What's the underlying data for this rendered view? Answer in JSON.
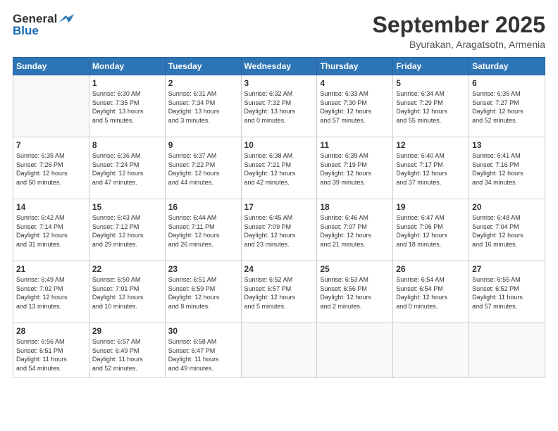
{
  "logo": {
    "line1": "General",
    "line2": "Blue"
  },
  "title": "September 2025",
  "subtitle": "Byurakan, Aragatsotn, Armenia",
  "days_of_week": [
    "Sunday",
    "Monday",
    "Tuesday",
    "Wednesday",
    "Thursday",
    "Friday",
    "Saturday"
  ],
  "weeks": [
    [
      {
        "day": "",
        "info": ""
      },
      {
        "day": "1",
        "info": "Sunrise: 6:30 AM\nSunset: 7:35 PM\nDaylight: 13 hours\nand 5 minutes."
      },
      {
        "day": "2",
        "info": "Sunrise: 6:31 AM\nSunset: 7:34 PM\nDaylight: 13 hours\nand 3 minutes."
      },
      {
        "day": "3",
        "info": "Sunrise: 6:32 AM\nSunset: 7:32 PM\nDaylight: 13 hours\nand 0 minutes."
      },
      {
        "day": "4",
        "info": "Sunrise: 6:33 AM\nSunset: 7:30 PM\nDaylight: 12 hours\nand 57 minutes."
      },
      {
        "day": "5",
        "info": "Sunrise: 6:34 AM\nSunset: 7:29 PM\nDaylight: 12 hours\nand 55 minutes."
      },
      {
        "day": "6",
        "info": "Sunrise: 6:35 AM\nSunset: 7:27 PM\nDaylight: 12 hours\nand 52 minutes."
      }
    ],
    [
      {
        "day": "7",
        "info": "Sunrise: 6:35 AM\nSunset: 7:26 PM\nDaylight: 12 hours\nand 50 minutes."
      },
      {
        "day": "8",
        "info": "Sunrise: 6:36 AM\nSunset: 7:24 PM\nDaylight: 12 hours\nand 47 minutes."
      },
      {
        "day": "9",
        "info": "Sunrise: 6:37 AM\nSunset: 7:22 PM\nDaylight: 12 hours\nand 44 minutes."
      },
      {
        "day": "10",
        "info": "Sunrise: 6:38 AM\nSunset: 7:21 PM\nDaylight: 12 hours\nand 42 minutes."
      },
      {
        "day": "11",
        "info": "Sunrise: 6:39 AM\nSunset: 7:19 PM\nDaylight: 12 hours\nand 39 minutes."
      },
      {
        "day": "12",
        "info": "Sunrise: 6:40 AM\nSunset: 7:17 PM\nDaylight: 12 hours\nand 37 minutes."
      },
      {
        "day": "13",
        "info": "Sunrise: 6:41 AM\nSunset: 7:16 PM\nDaylight: 12 hours\nand 34 minutes."
      }
    ],
    [
      {
        "day": "14",
        "info": "Sunrise: 6:42 AM\nSunset: 7:14 PM\nDaylight: 12 hours\nand 31 minutes."
      },
      {
        "day": "15",
        "info": "Sunrise: 6:43 AM\nSunset: 7:12 PM\nDaylight: 12 hours\nand 29 minutes."
      },
      {
        "day": "16",
        "info": "Sunrise: 6:44 AM\nSunset: 7:11 PM\nDaylight: 12 hours\nand 26 minutes."
      },
      {
        "day": "17",
        "info": "Sunrise: 6:45 AM\nSunset: 7:09 PM\nDaylight: 12 hours\nand 23 minutes."
      },
      {
        "day": "18",
        "info": "Sunrise: 6:46 AM\nSunset: 7:07 PM\nDaylight: 12 hours\nand 21 minutes."
      },
      {
        "day": "19",
        "info": "Sunrise: 6:47 AM\nSunset: 7:06 PM\nDaylight: 12 hours\nand 18 minutes."
      },
      {
        "day": "20",
        "info": "Sunrise: 6:48 AM\nSunset: 7:04 PM\nDaylight: 12 hours\nand 16 minutes."
      }
    ],
    [
      {
        "day": "21",
        "info": "Sunrise: 6:49 AM\nSunset: 7:02 PM\nDaylight: 12 hours\nand 13 minutes."
      },
      {
        "day": "22",
        "info": "Sunrise: 6:50 AM\nSunset: 7:01 PM\nDaylight: 12 hours\nand 10 minutes."
      },
      {
        "day": "23",
        "info": "Sunrise: 6:51 AM\nSunset: 6:59 PM\nDaylight: 12 hours\nand 8 minutes."
      },
      {
        "day": "24",
        "info": "Sunrise: 6:52 AM\nSunset: 6:57 PM\nDaylight: 12 hours\nand 5 minutes."
      },
      {
        "day": "25",
        "info": "Sunrise: 6:53 AM\nSunset: 6:56 PM\nDaylight: 12 hours\nand 2 minutes."
      },
      {
        "day": "26",
        "info": "Sunrise: 6:54 AM\nSunset: 6:54 PM\nDaylight: 12 hours\nand 0 minutes."
      },
      {
        "day": "27",
        "info": "Sunrise: 6:55 AM\nSunset: 6:52 PM\nDaylight: 11 hours\nand 57 minutes."
      }
    ],
    [
      {
        "day": "28",
        "info": "Sunrise: 6:56 AM\nSunset: 6:51 PM\nDaylight: 11 hours\nand 54 minutes."
      },
      {
        "day": "29",
        "info": "Sunrise: 6:57 AM\nSunset: 6:49 PM\nDaylight: 11 hours\nand 52 minutes."
      },
      {
        "day": "30",
        "info": "Sunrise: 6:58 AM\nSunset: 6:47 PM\nDaylight: 11 hours\nand 49 minutes."
      },
      {
        "day": "",
        "info": ""
      },
      {
        "day": "",
        "info": ""
      },
      {
        "day": "",
        "info": ""
      },
      {
        "day": "",
        "info": ""
      }
    ]
  ]
}
